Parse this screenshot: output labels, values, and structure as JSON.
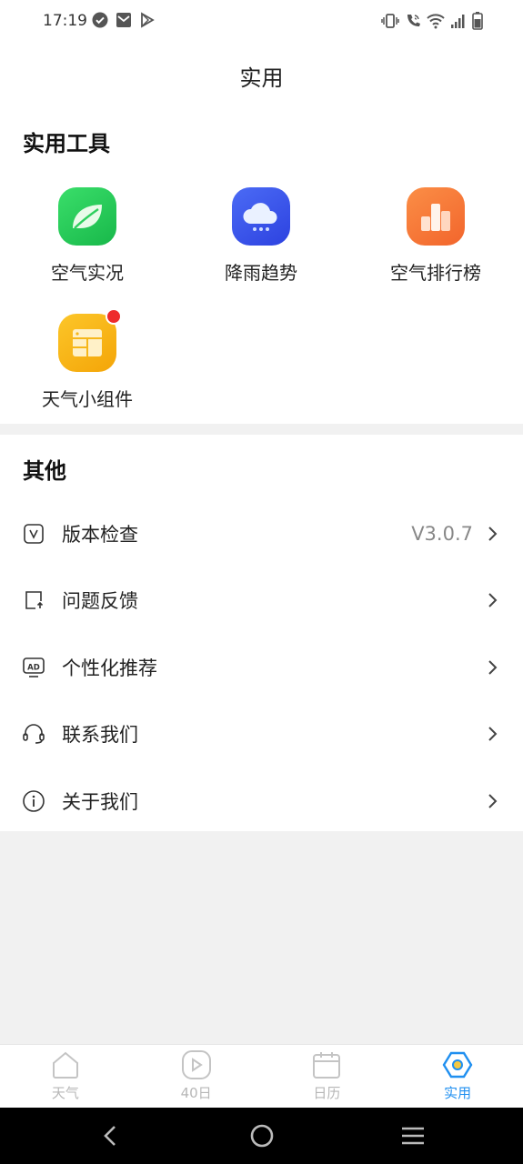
{
  "status": {
    "time": "17:19"
  },
  "header": {
    "title": "实用"
  },
  "tools": {
    "title": "实用工具",
    "items": [
      {
        "label": "空气实况",
        "icon": "leaf-icon",
        "color": "#22c55a"
      },
      {
        "label": "降雨趋势",
        "icon": "rain-cloud-icon",
        "color": "#3a55ea"
      },
      {
        "label": "空气排行榜",
        "icon": "ranking-icon",
        "color": "#f7783a"
      },
      {
        "label": "天气小组件",
        "icon": "widget-icon",
        "color": "#f8b20f",
        "badge": true
      }
    ]
  },
  "other": {
    "title": "其他",
    "items": [
      {
        "label": "版本检查",
        "value": "V3.0.7",
        "icon": "version-icon"
      },
      {
        "label": "问题反馈",
        "icon": "feedback-icon"
      },
      {
        "label": "个性化推荐",
        "icon": "ad-icon"
      },
      {
        "label": "联系我们",
        "icon": "headset-icon"
      },
      {
        "label": "关于我们",
        "icon": "info-icon"
      }
    ]
  },
  "tabs": [
    {
      "label": "天气",
      "icon": "home-icon",
      "active": false
    },
    {
      "label": "40日",
      "icon": "play-icon",
      "active": false
    },
    {
      "label": "日历",
      "icon": "calendar-icon",
      "active": false
    },
    {
      "label": "实用",
      "icon": "tools-hexagon-icon",
      "active": true
    }
  ],
  "colors": {
    "accent": "#1f8ff0",
    "inactive": "#b7b7b7",
    "badge": "#ee2b2b"
  }
}
